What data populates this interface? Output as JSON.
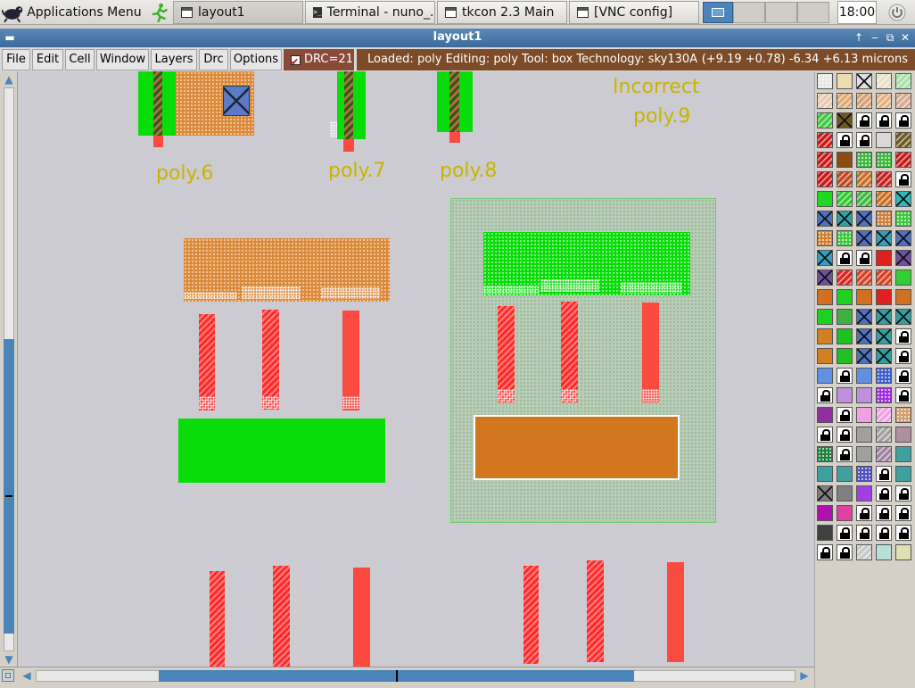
{
  "taskbar": {
    "apps_menu": "Applications Menu",
    "windows": [
      {
        "label": "layout1",
        "active": true
      },
      {
        "label": "Terminal - nuno_...",
        "active": false
      },
      {
        "label": "tkcon 2.3 Main",
        "active": false
      },
      {
        "label": "[VNC config]",
        "active": false
      }
    ],
    "clock": "18:00"
  },
  "window": {
    "title": "layout1"
  },
  "menu": {
    "items": [
      "File",
      "Edit",
      "Cell",
      "Window",
      "Layers",
      "Drc",
      "Options"
    ],
    "drc_label": "DRC=21",
    "status": "Loaded: poly Editing: poly Tool: box  Technology: sky130A",
    "coords": "(+9.19 +0.78) -6.34 +6.13 microns"
  },
  "canvas": {
    "labels": [
      "poly.6",
      "poly.7",
      "poly.8",
      "Incorrect",
      "poly.9"
    ]
  },
  "colors": {
    "poly": "#fb4a40",
    "diffusion": "#08dd0a",
    "pdiff": "#d98a3c",
    "nwell": "#b8ccb8",
    "label": "#c8b400",
    "accent": "#4a84b8"
  }
}
